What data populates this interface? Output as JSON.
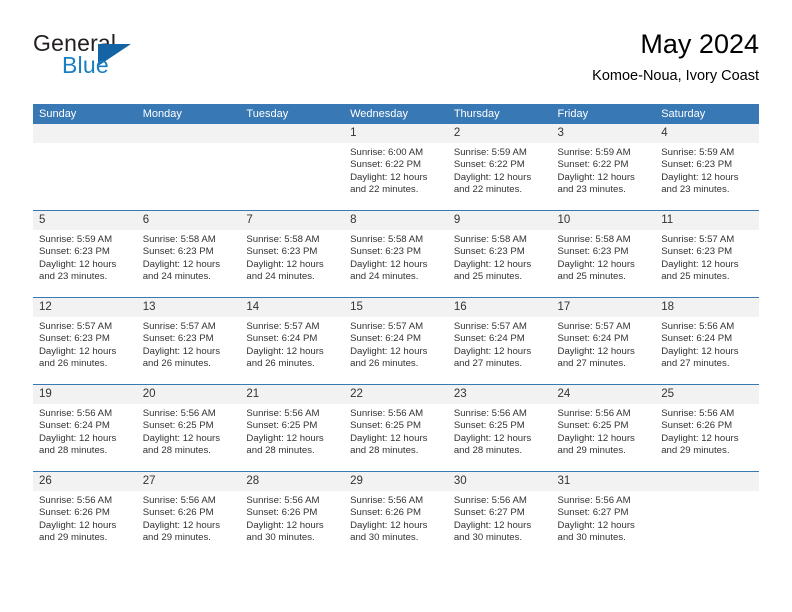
{
  "brand": {
    "name_part1": "General",
    "name_part2": "Blue",
    "logo_icon": "triangle-mark",
    "accent_color": "#1464a5",
    "blue_text_color": "#1a7fc1"
  },
  "header": {
    "title": "May 2024",
    "subtitle": "Komoe-Noua, Ivory Coast"
  },
  "theme": {
    "header_row_bg": "#3878b4",
    "daynum_bg": "#f2f2f2",
    "text_color": "#333333",
    "separator_color": "#3878b4"
  },
  "weekdays": [
    "Sunday",
    "Monday",
    "Tuesday",
    "Wednesday",
    "Thursday",
    "Friday",
    "Saturday"
  ],
  "weeks": [
    [
      {
        "day": "",
        "empty": true,
        "sunrise": "",
        "sunset": "",
        "daylight1": "",
        "daylight2": ""
      },
      {
        "day": "",
        "empty": true,
        "sunrise": "",
        "sunset": "",
        "daylight1": "",
        "daylight2": ""
      },
      {
        "day": "",
        "empty": true,
        "sunrise": "",
        "sunset": "",
        "daylight1": "",
        "daylight2": ""
      },
      {
        "day": "1",
        "empty": false,
        "sunrise": "Sunrise: 6:00 AM",
        "sunset": "Sunset: 6:22 PM",
        "daylight1": "Daylight: 12 hours",
        "daylight2": "and 22 minutes."
      },
      {
        "day": "2",
        "empty": false,
        "sunrise": "Sunrise: 5:59 AM",
        "sunset": "Sunset: 6:22 PM",
        "daylight1": "Daylight: 12 hours",
        "daylight2": "and 22 minutes."
      },
      {
        "day": "3",
        "empty": false,
        "sunrise": "Sunrise: 5:59 AM",
        "sunset": "Sunset: 6:22 PM",
        "daylight1": "Daylight: 12 hours",
        "daylight2": "and 23 minutes."
      },
      {
        "day": "4",
        "empty": false,
        "sunrise": "Sunrise: 5:59 AM",
        "sunset": "Sunset: 6:23 PM",
        "daylight1": "Daylight: 12 hours",
        "daylight2": "and 23 minutes."
      }
    ],
    [
      {
        "day": "5",
        "empty": false,
        "sunrise": "Sunrise: 5:59 AM",
        "sunset": "Sunset: 6:23 PM",
        "daylight1": "Daylight: 12 hours",
        "daylight2": "and 23 minutes."
      },
      {
        "day": "6",
        "empty": false,
        "sunrise": "Sunrise: 5:58 AM",
        "sunset": "Sunset: 6:23 PM",
        "daylight1": "Daylight: 12 hours",
        "daylight2": "and 24 minutes."
      },
      {
        "day": "7",
        "empty": false,
        "sunrise": "Sunrise: 5:58 AM",
        "sunset": "Sunset: 6:23 PM",
        "daylight1": "Daylight: 12 hours",
        "daylight2": "and 24 minutes."
      },
      {
        "day": "8",
        "empty": false,
        "sunrise": "Sunrise: 5:58 AM",
        "sunset": "Sunset: 6:23 PM",
        "daylight1": "Daylight: 12 hours",
        "daylight2": "and 24 minutes."
      },
      {
        "day": "9",
        "empty": false,
        "sunrise": "Sunrise: 5:58 AM",
        "sunset": "Sunset: 6:23 PM",
        "daylight1": "Daylight: 12 hours",
        "daylight2": "and 25 minutes."
      },
      {
        "day": "10",
        "empty": false,
        "sunrise": "Sunrise: 5:58 AM",
        "sunset": "Sunset: 6:23 PM",
        "daylight1": "Daylight: 12 hours",
        "daylight2": "and 25 minutes."
      },
      {
        "day": "11",
        "empty": false,
        "sunrise": "Sunrise: 5:57 AM",
        "sunset": "Sunset: 6:23 PM",
        "daylight1": "Daylight: 12 hours",
        "daylight2": "and 25 minutes."
      }
    ],
    [
      {
        "day": "12",
        "empty": false,
        "sunrise": "Sunrise: 5:57 AM",
        "sunset": "Sunset: 6:23 PM",
        "daylight1": "Daylight: 12 hours",
        "daylight2": "and 26 minutes."
      },
      {
        "day": "13",
        "empty": false,
        "sunrise": "Sunrise: 5:57 AM",
        "sunset": "Sunset: 6:23 PM",
        "daylight1": "Daylight: 12 hours",
        "daylight2": "and 26 minutes."
      },
      {
        "day": "14",
        "empty": false,
        "sunrise": "Sunrise: 5:57 AM",
        "sunset": "Sunset: 6:24 PM",
        "daylight1": "Daylight: 12 hours",
        "daylight2": "and 26 minutes."
      },
      {
        "day": "15",
        "empty": false,
        "sunrise": "Sunrise: 5:57 AM",
        "sunset": "Sunset: 6:24 PM",
        "daylight1": "Daylight: 12 hours",
        "daylight2": "and 26 minutes."
      },
      {
        "day": "16",
        "empty": false,
        "sunrise": "Sunrise: 5:57 AM",
        "sunset": "Sunset: 6:24 PM",
        "daylight1": "Daylight: 12 hours",
        "daylight2": "and 27 minutes."
      },
      {
        "day": "17",
        "empty": false,
        "sunrise": "Sunrise: 5:57 AM",
        "sunset": "Sunset: 6:24 PM",
        "daylight1": "Daylight: 12 hours",
        "daylight2": "and 27 minutes."
      },
      {
        "day": "18",
        "empty": false,
        "sunrise": "Sunrise: 5:56 AM",
        "sunset": "Sunset: 6:24 PM",
        "daylight1": "Daylight: 12 hours",
        "daylight2": "and 27 minutes."
      }
    ],
    [
      {
        "day": "19",
        "empty": false,
        "sunrise": "Sunrise: 5:56 AM",
        "sunset": "Sunset: 6:24 PM",
        "daylight1": "Daylight: 12 hours",
        "daylight2": "and 28 minutes."
      },
      {
        "day": "20",
        "empty": false,
        "sunrise": "Sunrise: 5:56 AM",
        "sunset": "Sunset: 6:25 PM",
        "daylight1": "Daylight: 12 hours",
        "daylight2": "and 28 minutes."
      },
      {
        "day": "21",
        "empty": false,
        "sunrise": "Sunrise: 5:56 AM",
        "sunset": "Sunset: 6:25 PM",
        "daylight1": "Daylight: 12 hours",
        "daylight2": "and 28 minutes."
      },
      {
        "day": "22",
        "empty": false,
        "sunrise": "Sunrise: 5:56 AM",
        "sunset": "Sunset: 6:25 PM",
        "daylight1": "Daylight: 12 hours",
        "daylight2": "and 28 minutes."
      },
      {
        "day": "23",
        "empty": false,
        "sunrise": "Sunrise: 5:56 AM",
        "sunset": "Sunset: 6:25 PM",
        "daylight1": "Daylight: 12 hours",
        "daylight2": "and 28 minutes."
      },
      {
        "day": "24",
        "empty": false,
        "sunrise": "Sunrise: 5:56 AM",
        "sunset": "Sunset: 6:25 PM",
        "daylight1": "Daylight: 12 hours",
        "daylight2": "and 29 minutes."
      },
      {
        "day": "25",
        "empty": false,
        "sunrise": "Sunrise: 5:56 AM",
        "sunset": "Sunset: 6:26 PM",
        "daylight1": "Daylight: 12 hours",
        "daylight2": "and 29 minutes."
      }
    ],
    [
      {
        "day": "26",
        "empty": false,
        "sunrise": "Sunrise: 5:56 AM",
        "sunset": "Sunset: 6:26 PM",
        "daylight1": "Daylight: 12 hours",
        "daylight2": "and 29 minutes."
      },
      {
        "day": "27",
        "empty": false,
        "sunrise": "Sunrise: 5:56 AM",
        "sunset": "Sunset: 6:26 PM",
        "daylight1": "Daylight: 12 hours",
        "daylight2": "and 29 minutes."
      },
      {
        "day": "28",
        "empty": false,
        "sunrise": "Sunrise: 5:56 AM",
        "sunset": "Sunset: 6:26 PM",
        "daylight1": "Daylight: 12 hours",
        "daylight2": "and 30 minutes."
      },
      {
        "day": "29",
        "empty": false,
        "sunrise": "Sunrise: 5:56 AM",
        "sunset": "Sunset: 6:26 PM",
        "daylight1": "Daylight: 12 hours",
        "daylight2": "and 30 minutes."
      },
      {
        "day": "30",
        "empty": false,
        "sunrise": "Sunrise: 5:56 AM",
        "sunset": "Sunset: 6:27 PM",
        "daylight1": "Daylight: 12 hours",
        "daylight2": "and 30 minutes."
      },
      {
        "day": "31",
        "empty": false,
        "sunrise": "Sunrise: 5:56 AM",
        "sunset": "Sunset: 6:27 PM",
        "daylight1": "Daylight: 12 hours",
        "daylight2": "and 30 minutes."
      },
      {
        "day": "",
        "empty": true,
        "sunrise": "",
        "sunset": "",
        "daylight1": "",
        "daylight2": ""
      }
    ]
  ]
}
